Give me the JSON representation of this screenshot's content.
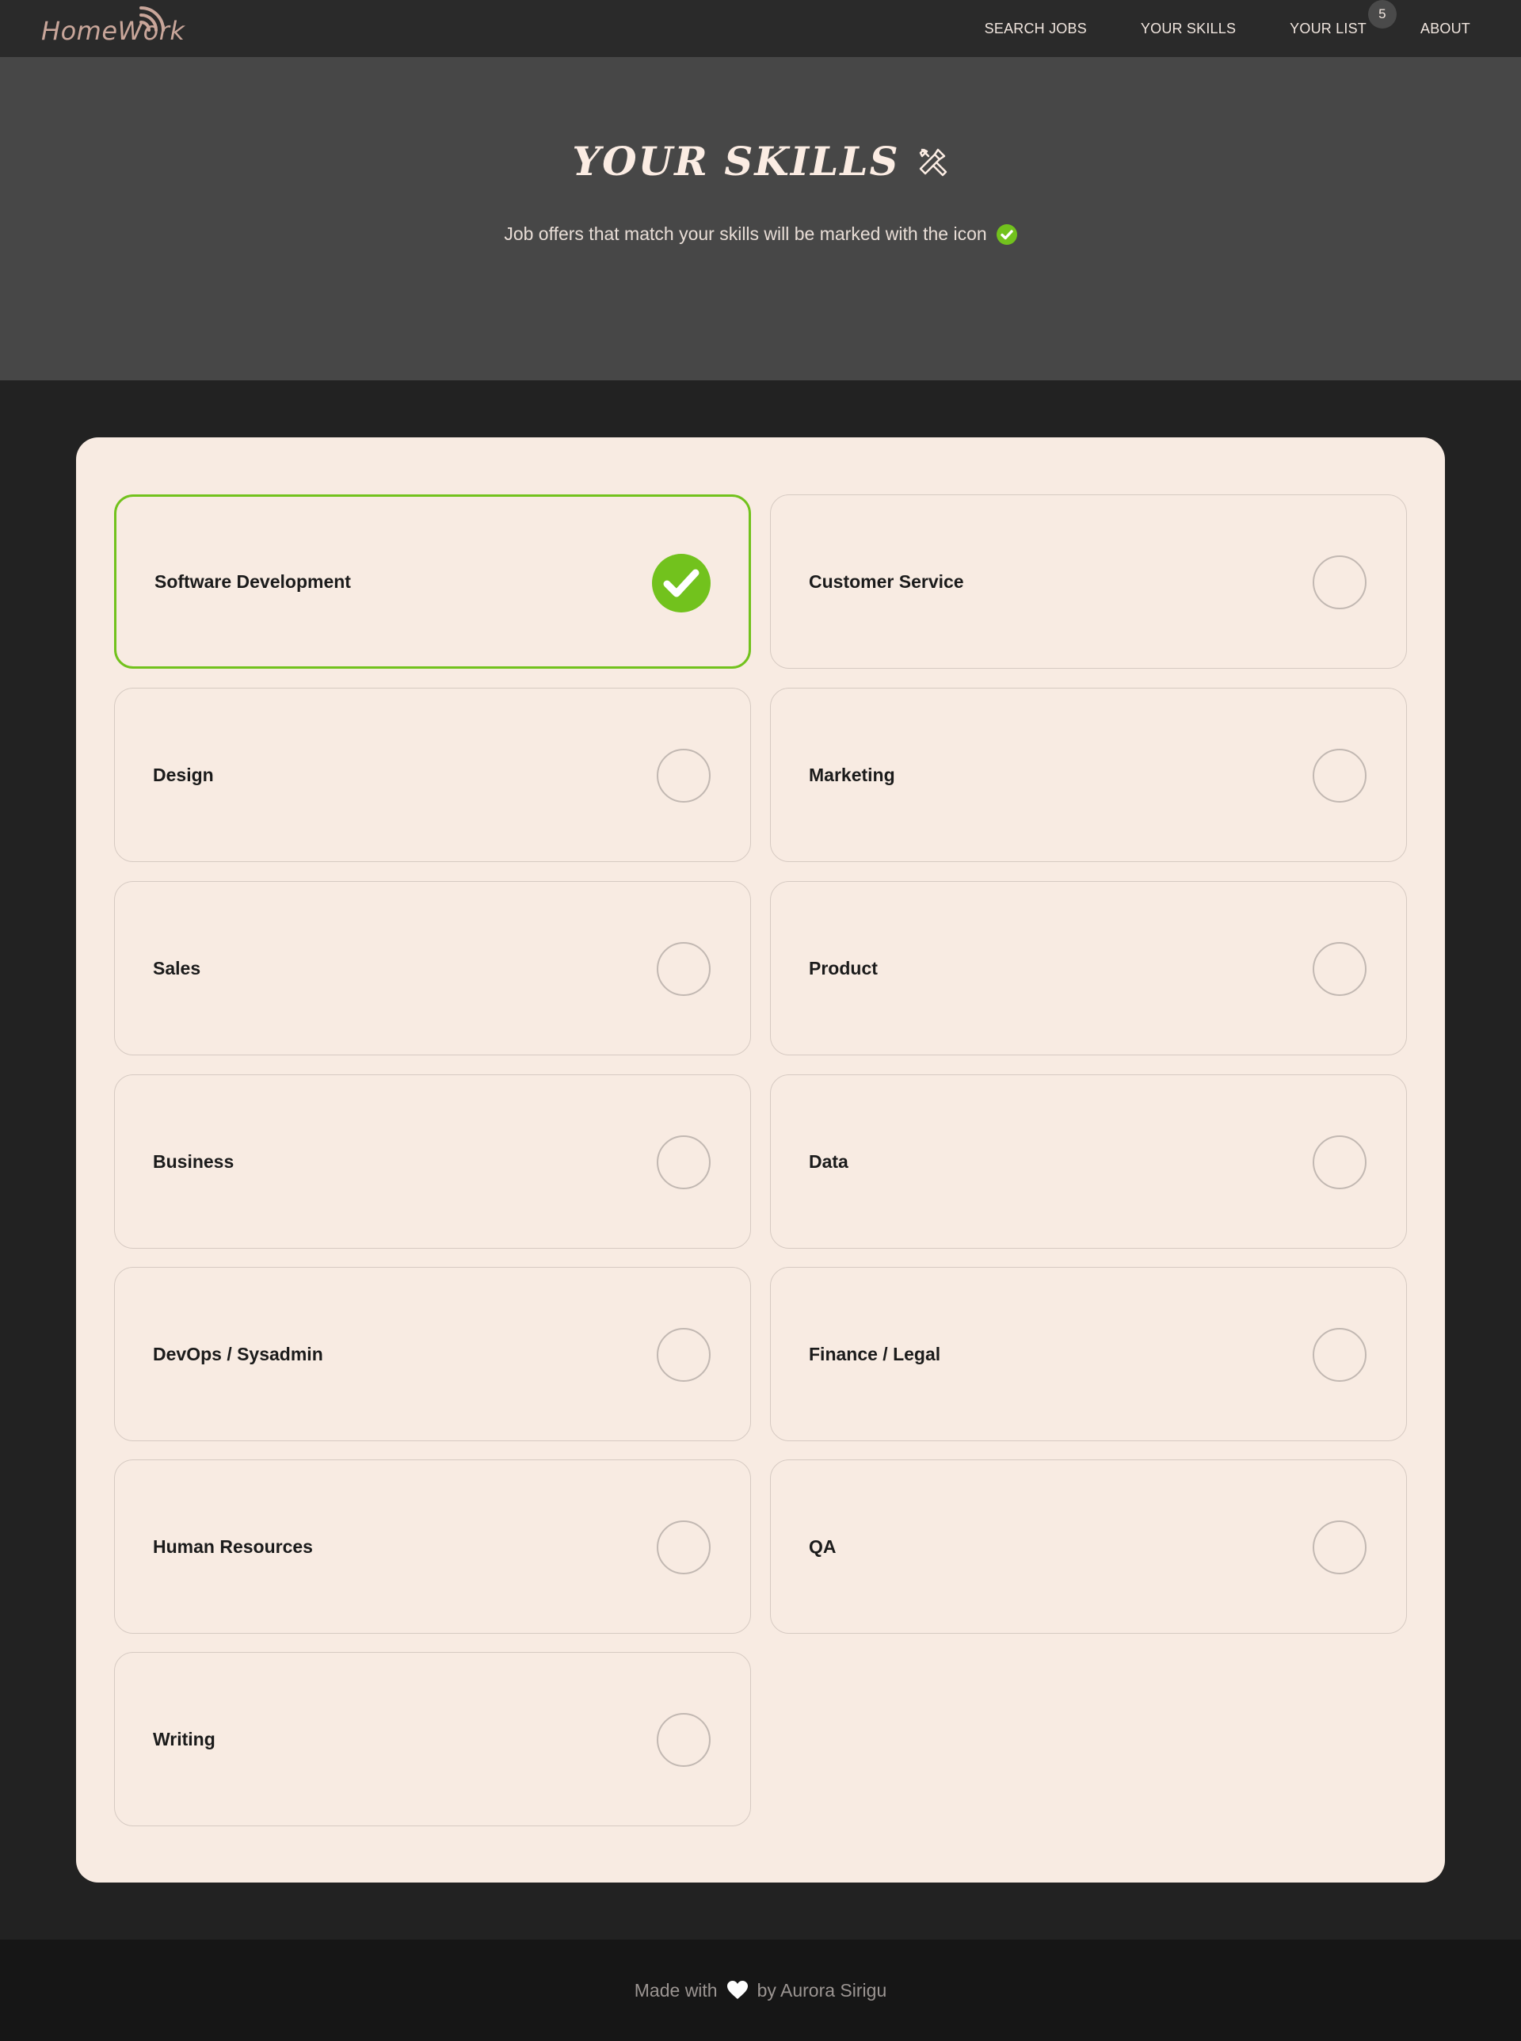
{
  "app": {
    "logo_text": "HomeWork"
  },
  "nav": {
    "items": [
      {
        "label": "SEARCH JOBS"
      },
      {
        "label": "YOUR SKILLS"
      },
      {
        "label": "YOUR LIST",
        "badge": "5"
      },
      {
        "label": "ABOUT"
      }
    ]
  },
  "hero": {
    "title": "YOUR SKILLS",
    "title_icon": "tools-icon",
    "subtitle": "Job offers that match your skills will be marked with the icon",
    "subtitle_icon": "check-circle-icon"
  },
  "skills": [
    {
      "label": "Software Development",
      "selected": true
    },
    {
      "label": "Customer Service",
      "selected": false
    },
    {
      "label": "Design",
      "selected": false
    },
    {
      "label": "Marketing",
      "selected": false
    },
    {
      "label": "Sales",
      "selected": false
    },
    {
      "label": "Product",
      "selected": false
    },
    {
      "label": "Business",
      "selected": false
    },
    {
      "label": "Data",
      "selected": false
    },
    {
      "label": "DevOps / Sysadmin",
      "selected": false
    },
    {
      "label": "Finance / Legal",
      "selected": false
    },
    {
      "label": "Human Resources",
      "selected": false
    },
    {
      "label": "QA",
      "selected": false
    },
    {
      "label": "Writing",
      "selected": false
    }
  ],
  "footer": {
    "prefix": "Made with",
    "icon": "heart-icon",
    "suffix": "by Aurora Sirigu"
  },
  "colors": {
    "accent_green": "#72c21d",
    "card_bg": "#f8ebe2",
    "hero_bg": "#474747",
    "page_bg": "#222222"
  }
}
